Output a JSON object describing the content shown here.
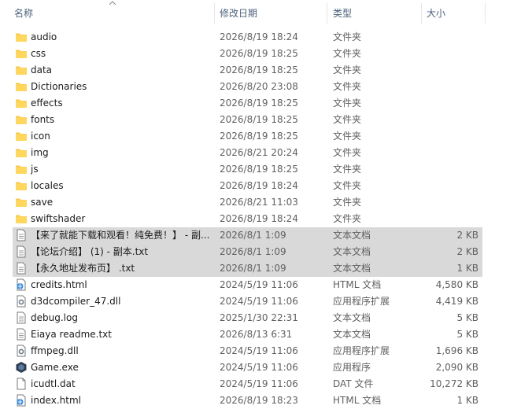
{
  "columns": {
    "name": "名称",
    "date": "修改日期",
    "type": "类型",
    "size": "大小"
  },
  "files": [
    {
      "name": "audio",
      "date": "2026/8/19 18:24",
      "type": "文件夹",
      "size": "",
      "icon": "folder-icon",
      "selected": false
    },
    {
      "name": "css",
      "date": "2026/8/19 18:25",
      "type": "文件夹",
      "size": "",
      "icon": "folder-icon",
      "selected": false
    },
    {
      "name": "data",
      "date": "2026/8/19 18:25",
      "type": "文件夹",
      "size": "",
      "icon": "folder-icon",
      "selected": false
    },
    {
      "name": "Dictionaries",
      "date": "2026/8/20 23:08",
      "type": "文件夹",
      "size": "",
      "icon": "folder-icon",
      "selected": false
    },
    {
      "name": "effects",
      "date": "2026/8/19 18:25",
      "type": "文件夹",
      "size": "",
      "icon": "folder-icon",
      "selected": false
    },
    {
      "name": "fonts",
      "date": "2026/8/19 18:25",
      "type": "文件夹",
      "size": "",
      "icon": "folder-icon",
      "selected": false
    },
    {
      "name": "icon",
      "date": "2026/8/19 18:25",
      "type": "文件夹",
      "size": "",
      "icon": "folder-icon",
      "selected": false
    },
    {
      "name": "img",
      "date": "2026/8/21 20:24",
      "type": "文件夹",
      "size": "",
      "icon": "folder-icon",
      "selected": false
    },
    {
      "name": "js",
      "date": "2026/8/19 18:25",
      "type": "文件夹",
      "size": "",
      "icon": "folder-icon",
      "selected": false
    },
    {
      "name": "locales",
      "date": "2026/8/19 18:24",
      "type": "文件夹",
      "size": "",
      "icon": "folder-icon",
      "selected": false
    },
    {
      "name": "save",
      "date": "2026/8/21 11:03",
      "type": "文件夹",
      "size": "",
      "icon": "folder-icon",
      "selected": false
    },
    {
      "name": "swiftshader",
      "date": "2026/8/19 18:24",
      "type": "文件夹",
      "size": "",
      "icon": "folder-icon",
      "selected": false
    },
    {
      "name": "【来了就能下载和观看！纯免费！】 - 副...",
      "date": "2026/8/1 1:09",
      "type": "文本文档",
      "size": "2 KB",
      "icon": "text-file-icon",
      "selected": true
    },
    {
      "name": "【论坛介绍】 (1) - 副本.txt",
      "date": "2026/8/1 1:09",
      "type": "文本文档",
      "size": "2 KB",
      "icon": "text-file-icon",
      "selected": true
    },
    {
      "name": "【永久地址发布页】 .txt",
      "date": "2026/8/1 1:09",
      "type": "文本文档",
      "size": "1 KB",
      "icon": "text-file-icon",
      "selected": true
    },
    {
      "name": "credits.html",
      "date": "2024/5/19 11:06",
      "type": "HTML 文档",
      "size": "4,580 KB",
      "icon": "html-file-icon",
      "selected": false
    },
    {
      "name": "d3dcompiler_47.dll",
      "date": "2024/5/19 11:06",
      "type": "应用程序扩展",
      "size": "4,419 KB",
      "icon": "dll-file-icon",
      "selected": false
    },
    {
      "name": "debug.log",
      "date": "2025/1/30 22:31",
      "type": "文本文档",
      "size": "5 KB",
      "icon": "text-file-icon",
      "selected": false
    },
    {
      "name": "Eiaya readme.txt",
      "date": "2026/8/13 6:31",
      "type": "文本文档",
      "size": "5 KB",
      "icon": "text-file-icon",
      "selected": false
    },
    {
      "name": "ffmpeg.dll",
      "date": "2024/5/19 11:06",
      "type": "应用程序扩展",
      "size": "1,696 KB",
      "icon": "dll-file-icon",
      "selected": false
    },
    {
      "name": "Game.exe",
      "date": "2024/5/19 11:06",
      "type": "应用程序",
      "size": "2,090 KB",
      "icon": "game-exe-icon",
      "selected": false
    },
    {
      "name": "icudtl.dat",
      "date": "2024/5/19 11:06",
      "type": "DAT 文件",
      "size": "10,272 KB",
      "icon": "blank-file-icon",
      "selected": false
    },
    {
      "name": "index.html",
      "date": "2026/8/19 18:23",
      "type": "HTML 文档",
      "size": "1 KB",
      "icon": "html-file-icon",
      "selected": false
    }
  ]
}
